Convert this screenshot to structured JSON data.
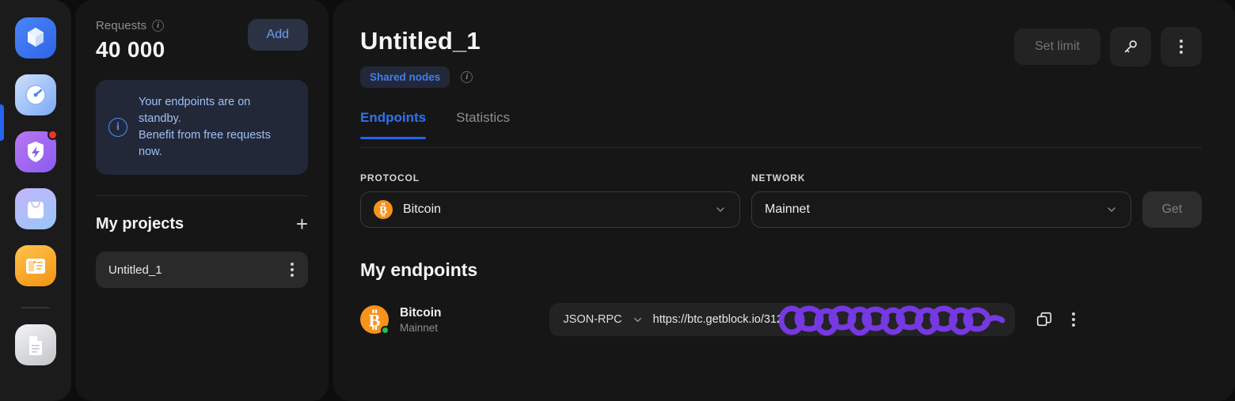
{
  "rail": {
    "items": [
      {
        "name": "cube-icon",
        "label": "Nodes"
      },
      {
        "name": "speedometer-icon",
        "label": "Dashboard"
      },
      {
        "name": "shield-bolt-icon",
        "label": "Boost"
      },
      {
        "name": "shopping-bag-icon",
        "label": "Marketplace"
      },
      {
        "name": "book-icon",
        "label": "Docs"
      },
      {
        "name": "document-icon",
        "label": "Files"
      }
    ],
    "active_index": 1,
    "badge_index": 2
  },
  "sidebar": {
    "requests_label": "Requests",
    "requests_value": "40 000",
    "add_label": "Add",
    "banner_line1": "Your endpoints are on standby.",
    "banner_line2": "Benefit from free requests now.",
    "banner_icon": "info-circle-icon",
    "projects_title": "My projects",
    "add_project_icon": "plus-icon",
    "projects": [
      {
        "name": "Untitled_1"
      }
    ]
  },
  "main": {
    "title": "Untitled_1",
    "badge": "Shared nodes",
    "badge_info_icon": "info-circle-icon",
    "set_limit_label": "Set limit",
    "key_icon": "key-icon",
    "more_icon": "kebab-menu-icon",
    "tabs": [
      {
        "label": "Endpoints",
        "active": true
      },
      {
        "label": "Statistics",
        "active": false
      }
    ],
    "protocol_label": "PROTOCOL",
    "protocol_value": "Bitcoin",
    "protocol_icon": "bitcoin-icon",
    "network_label": "NETWORK",
    "network_value": "Mainnet",
    "get_label": "Get",
    "endpoints_title": "My endpoints",
    "endpoints": [
      {
        "icon": "bitcoin-icon",
        "name": "Bitcoin",
        "network": "Mainnet",
        "status": "online",
        "rpc_type": "JSON-RPC",
        "url": "https://btc.getblock.io/312",
        "url_redacted": true,
        "copy_icon": "copy-icon",
        "more_icon": "kebab-menu-icon"
      }
    ]
  },
  "colors": {
    "accent_blue": "#2563f0",
    "badge_blue": "#3f7ef0",
    "bitcoin_orange": "#f7931a",
    "status_green": "#1fc44a",
    "redaction_purple": "#7c3aed",
    "alert_red": "#f0342f",
    "panel_bg": "#161616",
    "rail_bg": "#1b1b1b"
  }
}
